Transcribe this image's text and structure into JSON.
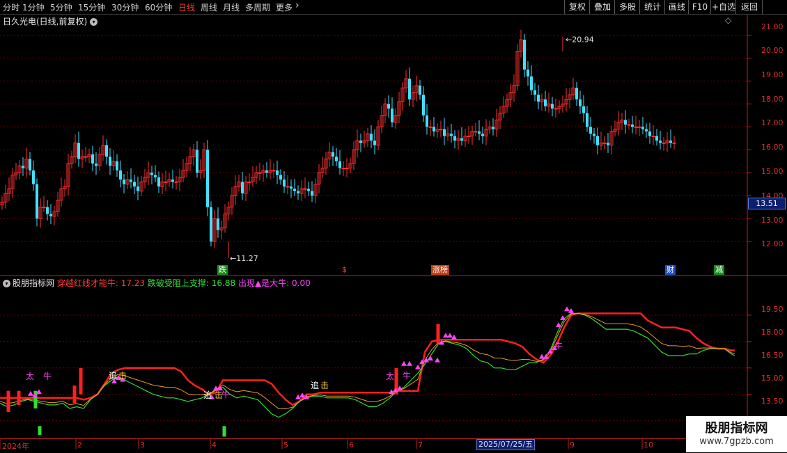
{
  "toolbar": {
    "periods": [
      "分时",
      "1分钟",
      "5分钟",
      "15分钟",
      "30分钟",
      "60分钟",
      "日线",
      "周线",
      "月线",
      "多周期",
      "更多"
    ],
    "active_period": "日线",
    "more_chevron": "›",
    "buttons": [
      "复权",
      "叠加",
      "多股",
      "统计",
      "画线",
      "F10",
      "+自选",
      "返回"
    ]
  },
  "stock": {
    "title": "日久光电(日线,前复权)",
    "circle_glyph": "▾",
    "diamond_glyph": "◇"
  },
  "indicator": {
    "name": "股朋指标网",
    "legend": [
      {
        "label": "穿越红线才能牛: 17.23",
        "color": "#ff3b3b"
      },
      {
        "label": "跌破受阻上支撑: 16.88",
        "color": "#33e333"
      },
      {
        "label": "出现▲是大牛: 0.00",
        "color": "#ff44ff"
      }
    ]
  },
  "price_axis": {
    "labels": [
      "21.00",
      "20.00",
      "19.00",
      "18.00",
      "17.00",
      "16.00",
      "15.00",
      "14.00",
      "13.00",
      "12.00"
    ],
    "current": "13.51"
  },
  "indicator_axis": {
    "labels": [
      "19.50",
      "18.00",
      "16.50",
      "15.00",
      "13.50"
    ]
  },
  "x_axis": {
    "months": [
      "2024年",
      "2",
      "3",
      "4",
      "5",
      "6",
      "7",
      "8",
      "9",
      "10"
    ],
    "cursor_date": "2025/07/25/五"
  },
  "annotations": {
    "high": "←20.94",
    "low": "←11.27"
  },
  "events": [
    {
      "text": "跌",
      "color": "#fff",
      "bg": "#1a8a1a"
    },
    {
      "text": "$",
      "color": "#ff3b3b",
      "bg": ""
    },
    {
      "text": "涨榜",
      "color": "#fff",
      "bg": "#b8401a"
    },
    {
      "text": "财",
      "color": "#fff",
      "bg": "#2050c0"
    },
    {
      "text": "减",
      "color": "#fff",
      "bg": "#1a8a1a"
    }
  ],
  "signals": {
    "buy": "太",
    "chase": "追",
    "strike": "击",
    "bull": "牛"
  },
  "watermark": {
    "line1": "股朋指标网",
    "line2": "www.7gpzb.com"
  },
  "colors": {
    "up": "#ff3030",
    "down": "#40e0ff",
    "grid": "#7a0000",
    "background": "#000000"
  },
  "chart_data": [
    {
      "type": "candlestick",
      "title": "日久光电(日线,前复权)",
      "x": [
        0,
        5,
        10,
        15,
        20,
        25,
        30,
        35,
        40,
        45,
        50,
        55,
        60,
        65,
        70,
        75,
        80,
        85,
        90,
        95,
        100,
        105,
        110,
        115,
        120,
        125,
        130,
        135,
        140,
        145,
        150,
        155,
        160,
        165,
        170,
        175,
        180,
        185,
        190,
        195,
        200,
        205,
        210,
        215,
        220,
        225,
        230,
        235,
        240,
        245,
        250,
        255,
        260,
        265,
        270,
        275,
        280,
        285,
        290,
        295,
        300,
        305,
        310,
        315,
        320,
        325,
        330,
        335,
        340,
        345,
        350,
        355,
        360,
        365,
        370,
        375,
        380,
        385,
        390,
        395,
        400,
        405,
        410,
        415,
        420,
        425,
        430,
        435,
        440,
        445,
        450,
        455,
        460,
        465,
        470,
        475,
        480,
        485,
        490,
        495,
        500,
        505,
        510,
        515,
        520,
        525,
        530,
        535,
        540,
        545,
        550,
        555,
        560,
        565,
        570,
        575,
        580,
        585,
        590,
        595,
        600,
        605,
        610,
        615,
        620,
        625,
        630,
        635,
        640,
        645,
        650,
        655,
        660,
        665,
        670,
        675,
        680,
        685,
        690,
        695,
        700,
        705,
        710,
        715,
        720,
        725,
        730,
        735,
        740,
        745,
        750,
        755,
        760,
        765,
        770,
        775,
        780,
        785,
        790,
        795,
        800,
        805,
        810,
        815,
        820,
        825,
        830,
        835,
        840,
        845,
        850,
        855,
        860,
        865,
        870,
        875,
        880,
        885,
        890,
        895,
        900,
        905,
        910,
        915,
        920,
        925,
        930,
        935,
        940,
        945,
        950,
        955,
        960,
        965,
        970,
        975,
        980,
        985,
        990,
        995,
        1000,
        1005,
        1010,
        1015,
        1020,
        1025,
        1030,
        1035,
        1040,
        1045,
        1050,
        1055
      ],
      "close": [
        13.72,
        14.1,
        14.3,
        14.9,
        15.0,
        15.3,
        15.2,
        15.6,
        15.1,
        14.5,
        13.0,
        13.5,
        13.5,
        13.2,
        13.1,
        13.3,
        13.8,
        14.3,
        14.4,
        15.4,
        15.7,
        16.3,
        15.6,
        15.7,
        15.7,
        15.8,
        15.4,
        15.3,
        15.8,
        16.2,
        15.7,
        15.3,
        15.5,
        15.1,
        14.7,
        14.5,
        14.7,
        14.6,
        14.4,
        14.2,
        14.6,
        14.8,
        15.0,
        14.9,
        14.8,
        14.4,
        14.6,
        14.6,
        14.7,
        14.6,
        14.6,
        14.8,
        15.1,
        15.4,
        15.7,
        16.0,
        15.0,
        15.1,
        16.0,
        13.5,
        12.0,
        13.0,
        12.5,
        12.6,
        13.2,
        13.5,
        14.0,
        14.4,
        14.6,
        14.1,
        14.6,
        14.6,
        14.8,
        15.0,
        15.0,
        15.1,
        15.0,
        15.1,
        15.1,
        14.9,
        14.7,
        14.4,
        14.4,
        14.3,
        14.2,
        14.1,
        14.3,
        14.3,
        14.2,
        14.0,
        14.5,
        15.0,
        15.2,
        15.6,
        15.9,
        15.7,
        15.5,
        15.2,
        15.2,
        15.2,
        15.4,
        16.0,
        16.4,
        16.3,
        16.4,
        16.7,
        16.4,
        16.2,
        17.0,
        17.5,
        18.0,
        17.8,
        17.2,
        17.5,
        18.1,
        18.7,
        19.1,
        18.2,
        18.5,
        18.8,
        18.4,
        17.5,
        17.0,
        17.0,
        16.8,
        16.9,
        16.9,
        16.6,
        16.7,
        16.6,
        16.4,
        16.5,
        16.4,
        16.6,
        16.6,
        16.8,
        16.8,
        16.7,
        16.6,
        16.9,
        17.0,
        16.9,
        17.3,
        17.6,
        17.9,
        18.2,
        18.5,
        18.8,
        20.3,
        20.8,
        19.5,
        19.2,
        18.6,
        18.4,
        18.1,
        18.2,
        17.9,
        18.0,
        17.8,
        17.8,
        17.9,
        18.0,
        18.2,
        18.4,
        18.7,
        18.2,
        17.9,
        17.6,
        17.0,
        16.7,
        16.6,
        16.2,
        16.3,
        16.3,
        16.2,
        16.8,
        16.9,
        17.2,
        17.3,
        17.1,
        17.1,
        17.0,
        17.0,
        17.0,
        16.9,
        16.8,
        16.6,
        16.6,
        16.4,
        16.3,
        16.3,
        16.4,
        16.3,
        16.3
      ],
      "ylim": [
        11.0,
        21.5
      ],
      "high_annotation": 20.94,
      "low_annotation": 11.27,
      "current_price": 13.51
    },
    {
      "type": "line",
      "title": "股朋指标网",
      "ylim": [
        12.5,
        20.8
      ],
      "x": [
        0,
        10,
        20,
        30,
        40,
        50,
        60,
        70,
        80,
        90,
        100,
        110,
        120,
        130,
        140,
        150,
        160,
        170,
        180,
        190,
        200,
        210,
        220,
        230,
        240,
        250,
        260,
        270,
        280,
        290,
        300,
        310,
        320,
        330,
        340,
        350,
        360,
        370,
        380,
        390,
        400,
        410,
        420,
        430,
        440,
        450,
        460,
        470,
        480,
        490,
        500,
        510,
        520,
        530,
        540,
        550,
        560,
        570,
        580,
        590,
        600,
        610,
        620,
        630,
        640,
        650,
        660,
        670,
        680,
        690,
        700,
        710,
        720,
        730,
        740,
        750,
        760,
        770,
        780,
        790,
        800,
        810,
        820,
        830,
        840,
        850,
        860,
        870,
        880,
        890,
        900,
        910,
        920,
        930,
        940,
        950,
        960,
        970,
        980,
        990,
        1000,
        1010,
        1020,
        1030,
        1040,
        1050,
        1055
      ],
      "series": [
        {
          "name": "穿越红线才能牛",
          "color": "#ff2020",
          "values": [
            14.8,
            14.8,
            14.8,
            14.8,
            14.8,
            14.8,
            14.8,
            14.8,
            14.8,
            14.8,
            14.8,
            14.8,
            14.7,
            14.8,
            15.0,
            15.6,
            16.2,
            16.4,
            16.5,
            16.5,
            16.5,
            16.5,
            16.5,
            16.5,
            16.5,
            16.5,
            16.3,
            15.8,
            15.5,
            15.3,
            15.0,
            15.1,
            15.8,
            15.8,
            15.8,
            15.8,
            15.8,
            15.8,
            15.8,
            15.6,
            15.1,
            14.7,
            14.4,
            14.6,
            15.0,
            15.0,
            15.1,
            15.1,
            15.1,
            15.1,
            15.1,
            15.1,
            15.1,
            15.1,
            15.1,
            15.1,
            15.1,
            15.2,
            15.2,
            15.2,
            15.2,
            17.4,
            18.0,
            18.1,
            18.1,
            18.1,
            18.1,
            18.1,
            18.1,
            18.1,
            18.1,
            18.1,
            18.1,
            18.0,
            17.9,
            17.7,
            17.3,
            17.0,
            16.8,
            17.2,
            17.9,
            18.8,
            19.5,
            19.6,
            19.6,
            19.6,
            19.6,
            19.6,
            19.6,
            19.6,
            19.6,
            19.6,
            19.6,
            19.2,
            19.0,
            18.8,
            18.8,
            18.8,
            18.7,
            18.6,
            18.2,
            17.9,
            17.7,
            17.6,
            17.6,
            17.5,
            17.5
          ]
        },
        {
          "name": "跌破受阻上支撑",
          "color": "#33dd33",
          "values": [
            14.5,
            14.3,
            14.4,
            14.6,
            14.7,
            14.6,
            14.5,
            14.4,
            14.4,
            14.5,
            14.2,
            14.3,
            14.2,
            14.7,
            15.0,
            15.5,
            15.8,
            16.0,
            15.8,
            15.6,
            15.4,
            15.2,
            15.0,
            14.9,
            14.8,
            14.8,
            14.7,
            14.6,
            14.7,
            14.8,
            15.0,
            15.3,
            15.4,
            15.0,
            14.8,
            14.9,
            14.8,
            14.7,
            14.3,
            13.9,
            13.7,
            13.9,
            14.2,
            14.6,
            14.8,
            14.9,
            14.9,
            14.8,
            14.8,
            14.8,
            14.8,
            14.7,
            14.5,
            14.3,
            14.3,
            14.5,
            14.8,
            15.2,
            15.4,
            15.8,
            16.2,
            16.7,
            17.3,
            17.9,
            18.0,
            17.9,
            17.8,
            17.6,
            17.2,
            16.9,
            16.8,
            16.5,
            16.5,
            16.4,
            16.4,
            16.6,
            16.8,
            16.8,
            17.0,
            17.5,
            18.5,
            19.3,
            19.6,
            19.6,
            19.5,
            19.3,
            19.0,
            18.7,
            18.7,
            18.7,
            18.7,
            18.6,
            18.4,
            18.2,
            17.8,
            17.4,
            17.2,
            17.2,
            17.2,
            17.3,
            17.3,
            17.5,
            17.6,
            17.6,
            17.6,
            17.3,
            17.2
          ]
        }
      ]
    }
  ]
}
